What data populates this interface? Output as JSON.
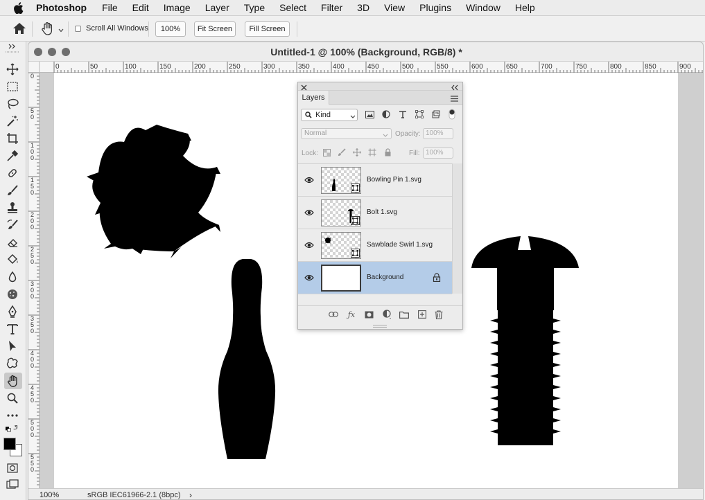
{
  "menubar": {
    "app": "Photoshop",
    "items": [
      "File",
      "Edit",
      "Image",
      "Layer",
      "Type",
      "Select",
      "Filter",
      "3D",
      "View",
      "Plugins",
      "Window",
      "Help"
    ]
  },
  "options": {
    "scroll_all_windows": "Scroll All Windows",
    "zoom_value": "100%",
    "fit_screen": "Fit Screen",
    "fill_screen": "Fill Screen"
  },
  "document": {
    "title": "Untitled-1 @ 100% (Background, RGB/8) *",
    "ruler_h": [
      "0",
      "50",
      "100",
      "150",
      "200",
      "250",
      "300",
      "350",
      "400",
      "450",
      "500",
      "550",
      "600",
      "650",
      "700",
      "750",
      "800",
      "850",
      "900"
    ],
    "ruler_v": [
      "0",
      "5\n0",
      "1\n0\n0",
      "1\n5\n0",
      "2\n0\n0",
      "2\n5\n0",
      "3\n0\n0",
      "3\n5\n0",
      "4\n0\n0",
      "4\n5\n0",
      "5\n0\n0",
      "5\n5\n0"
    ]
  },
  "status": {
    "zoom": "100%",
    "profile": "sRGB IEC61966-2.1 (8bpc)",
    "arrow": "›"
  },
  "layers_panel": {
    "tab": "Layers",
    "filter_kind": "Kind",
    "blend_mode": "Normal",
    "opacity_label": "Opacity:",
    "opacity_value": "100%",
    "lock_label": "Lock:",
    "fill_label": "Fill:",
    "fill_value": "100%",
    "layers": [
      {
        "name": "Bowling Pin 1.svg",
        "selected": false
      },
      {
        "name": "Bolt 1.svg",
        "selected": false
      },
      {
        "name": "Sawblade Swirl 1.svg",
        "selected": false
      },
      {
        "name": "Background",
        "selected": true,
        "locked": true
      }
    ]
  },
  "colors": {
    "selected_layer": "#b4cce8",
    "canvas": "#ffffff",
    "pasteboard": "#cfcfcf",
    "foreground": "#000000",
    "background": "#ffffff"
  }
}
